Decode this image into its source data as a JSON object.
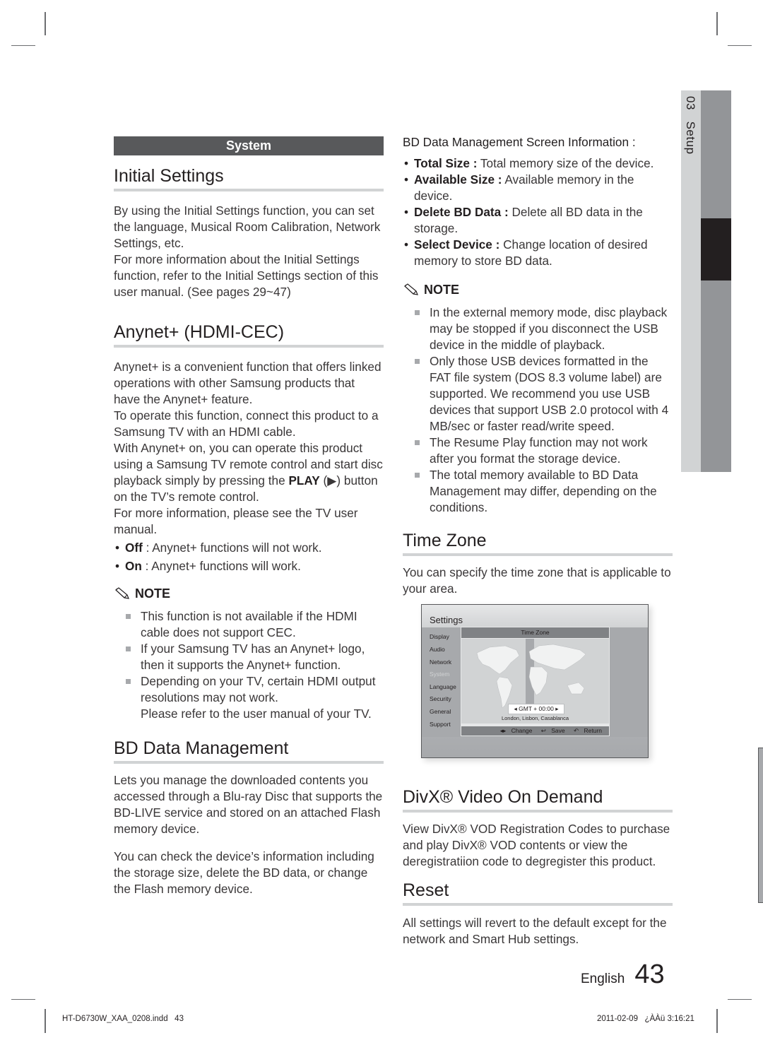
{
  "side_tab": {
    "chapter": "03",
    "label": "Setup"
  },
  "left": {
    "section_bar": "System",
    "initial_settings": {
      "title": "Initial Settings",
      "paragraphs": [
        "By using the Initial Settings function, you can set the language, Musical Room Calibration, Network Settings, etc.",
        "For more information about the Initial Settings function, refer to the Initial Settings section of this user manual. (See pages 29~47)"
      ]
    },
    "anynet": {
      "title": "Anynet+ (HDMI-CEC)",
      "paragraphs": [
        "Anynet+ is a convenient function that offers linked operations with other Samsung products that have the Anynet+ feature.",
        "To operate this function, connect this product to a Samsung TV with an HDMI cable."
      ],
      "play_para": {
        "before": "With Anynet+ on, you can operate this product using a Samsung TV remote control and start disc playback simply by pressing the ",
        "bold": "PLAY",
        "after": " (▶) button on the TV’s remote control."
      },
      "more_info": "For more information, please see the TV user manual.",
      "options": [
        {
          "term": "Off",
          "desc": " : Anynet+ functions will not work."
        },
        {
          "term": "On",
          "desc": " : Anynet+ functions will work."
        }
      ],
      "note_label": "NOTE",
      "notes": [
        "This function is not available if the HDMI cable does not support CEC.",
        "If your Samsung TV has an Anynet+ logo, then it supports the Anynet+ function.",
        "Depending on your TV, certain HDMI output resolutions may not work."
      ],
      "note_continuation": "Please refer to the user manual of your TV."
    },
    "bd_data": {
      "title": "BD Data Management",
      "paragraphs": [
        "Lets you manage the downloaded contents you accessed through a Blu-ray Disc that supports the BD-LIVE service and stored on an attached Flash memory device.",
        "You can check the device’s information including the storage size, delete the BD data, or change the Flash memory device."
      ]
    }
  },
  "right": {
    "screen_info": {
      "heading": "BD Data Management Screen Information :",
      "items": [
        {
          "term": "Total Size :",
          "desc": " Total memory size of the device."
        },
        {
          "term": "Available Size :",
          "desc": " Available memory in the device."
        },
        {
          "term": "Delete BD Data :",
          "desc": " Delete all BD data in the storage."
        },
        {
          "term": "Select Device :",
          "desc": " Change location of desired memory to store BD data."
        }
      ],
      "note_label": "NOTE",
      "notes": [
        "In the external memory mode, disc playback may be stopped if you disconnect the USB device in the middle of playback.",
        "Only those USB devices formatted in the FAT file system (DOS 8.3 volume label) are supported. We recommend you use USB devices that support USB 2.0 protocol with 4 MB/sec or faster read/write speed.",
        "The Resume Play function may not work after you format the storage device.",
        "The total memory available to BD Data Management may differ, depending on the conditions."
      ]
    },
    "time_zone": {
      "title": "Time Zone",
      "text": "You can specify the time zone that is applicable to your area.",
      "screenshot": {
        "title": "Settings",
        "menu": [
          "Display",
          "Audio",
          "Network",
          "System",
          "Language",
          "Security",
          "General",
          "Support"
        ],
        "active_menu": "System",
        "panel_title": "Time Zone",
        "gmt_value": "GMT + 00:00",
        "cities": "London, Lisbon, Casablanca",
        "footer": {
          "change": "Change",
          "save": "Save",
          "return": "Return"
        }
      }
    },
    "divx": {
      "title": "DivX® Video On Demand",
      "text": "View DivX® VOD Registration Codes to purchase and play DivX® VOD contents or view the deregistratiion code to degregister this product."
    },
    "reset": {
      "title": "Reset",
      "text": "All settings will revert to the default except for the network and Smart Hub settings."
    }
  },
  "page": {
    "language": "English",
    "number": "43"
  },
  "slug": {
    "file": "HT-D6730W_XAA_0208.indd   43",
    "timestamp": "2011-02-09   ¿ÀÀü 3:16:21"
  }
}
